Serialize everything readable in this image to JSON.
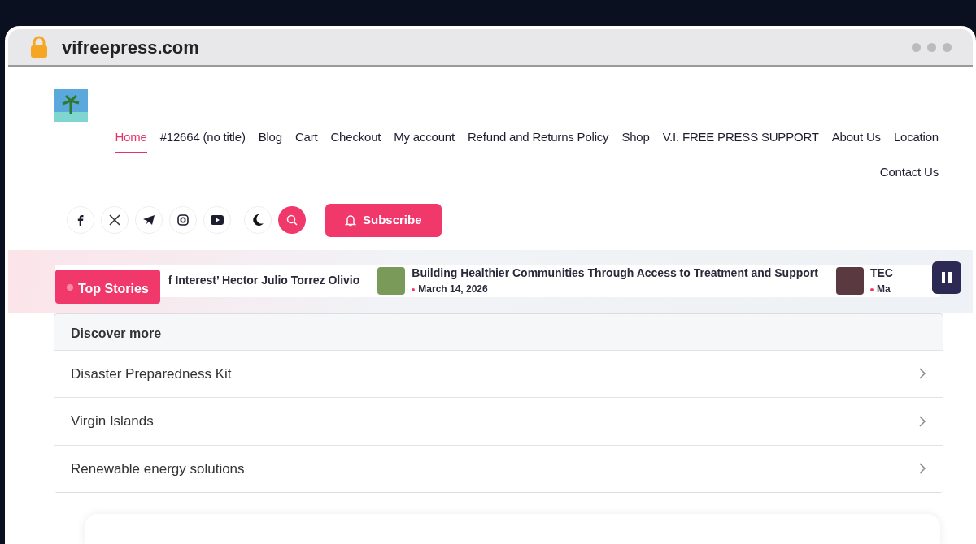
{
  "browser": {
    "url": "vifreepress.com"
  },
  "nav": [
    {
      "label": "Home",
      "selected": true
    },
    {
      "label": "#12664 (no title)",
      "selected": false
    },
    {
      "label": "Blog",
      "selected": false
    },
    {
      "label": "Cart",
      "selected": false
    },
    {
      "label": "Checkout",
      "selected": false
    },
    {
      "label": "My account",
      "selected": false
    },
    {
      "label": "Refund and Returns Policy",
      "selected": false
    },
    {
      "label": "Shop",
      "selected": false
    },
    {
      "label": "V.I. FREE PRESS SUPPORT",
      "selected": false
    },
    {
      "label": "About Us",
      "selected": false
    },
    {
      "label": "Location",
      "selected": false
    },
    {
      "label": "Contact Us",
      "selected": false
    }
  ],
  "subscribe": {
    "label": "Subscribe"
  },
  "ticker": {
    "label": "Top Stories",
    "items": [
      {
        "title": "f Interest’ Hector Julio Torrez Olivio"
      },
      {
        "title": "Building Healthier Communities Through Access to Treatment and Support",
        "date": "March 14, 2026"
      },
      {
        "title": "TEC",
        "date": "Ma"
      }
    ]
  },
  "discover": {
    "title": "Discover more",
    "items": [
      "Disaster Preparedness Kit",
      "Virgin Islands",
      "Renewable energy solutions"
    ]
  }
}
